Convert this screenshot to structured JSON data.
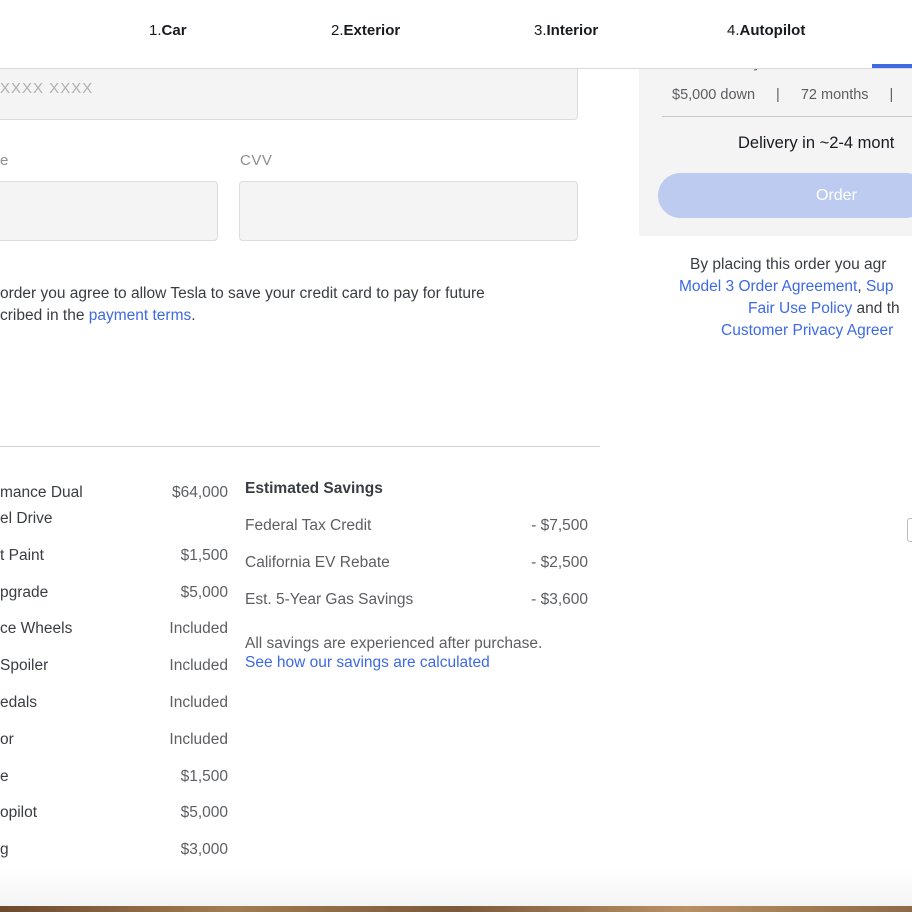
{
  "nav": {
    "steps": [
      {
        "num": "1.",
        "label": "Car"
      },
      {
        "num": "2.",
        "label": "Exterior"
      },
      {
        "num": "3.",
        "label": "Interior"
      },
      {
        "num": "4.",
        "label": "Autopilot"
      }
    ]
  },
  "payment_form": {
    "card_number_placeholder": "XXXX  XXXX",
    "expiry_label": "e",
    "cvv_label": "CVV",
    "consent_line1": "order you agree to allow Tesla to save your credit card to pay for future",
    "consent_line2_pre": "cribed in the ",
    "consent_link": "payment terms",
    "consent_line2_post": "."
  },
  "line_items": [
    {
      "name": "mance Dual",
      "name2": "el Drive",
      "price": "$64,000"
    },
    {
      "name": "t Paint",
      "price": "$1,500"
    },
    {
      "name": "pgrade",
      "price": "$5,000"
    },
    {
      "name": "ce Wheels",
      "price": "Included"
    },
    {
      "name": "Spoiler",
      "price": "Included"
    },
    {
      "name": "edals",
      "price": "Included"
    },
    {
      "name": "or",
      "price": "Included"
    },
    {
      "name": "e",
      "price": "$1,500"
    },
    {
      "name": "opilot",
      "price": "$5,000"
    },
    {
      "name": "g",
      "price": "$3,000"
    }
  ],
  "savings": {
    "title": "Estimated Savings",
    "items": [
      {
        "name": "Federal Tax Credit",
        "value": "- $7,500"
      },
      {
        "name": "California EV Rebate",
        "value": "- $2,500"
      },
      {
        "name": "Est. 5-Year Gas Savings",
        "value": "- $3,600"
      }
    ],
    "note": "All savings are experienced after purchase.",
    "link": "See how our savings are calculated"
  },
  "order_panel": {
    "loan_label": "Est. Loan Payment",
    "down": "$5,000 down",
    "sep": "|",
    "term": "72 months",
    "delivery": "Delivery in ~2-4 mont",
    "order_button": "Order",
    "legal_line1": "By placing this order you agr",
    "legal_link1": "Model 3 Order Agreement",
    "legal_comma": ", ",
    "legal_link2": "Sup",
    "legal_link3": "Fair Use Policy",
    "legal_and": " and th",
    "legal_link4": "Customer Privacy Agreer"
  },
  "colors": {
    "accent": "#3e6ae1",
    "order_button_disabled": "#bccbef",
    "panel_bg": "#f4f4f4",
    "input_bg": "#f4f4f4"
  }
}
